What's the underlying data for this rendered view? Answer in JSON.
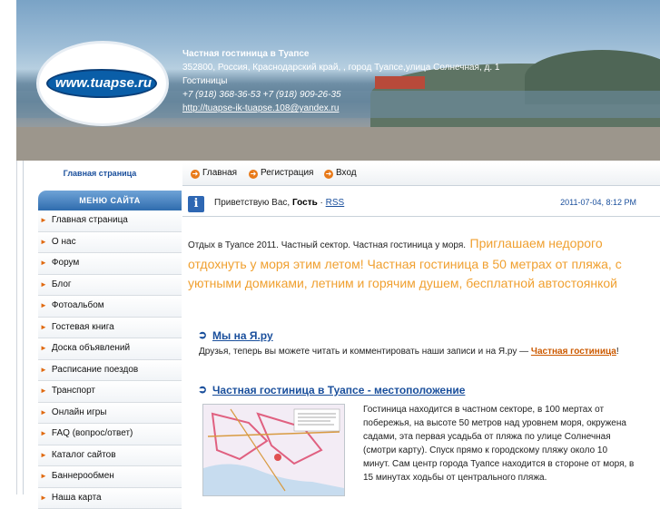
{
  "header": {
    "logo_text": "www.tuapse.ru",
    "title": "Частная гостиница в Туапсе",
    "address": "352800, Россия, Краснодарский край, , город Туапсе,улица Солнечная, д. 1",
    "category": "Гостиницы",
    "phones": "+7 (918) 368-36-53 +7 (918) 909-26-35",
    "email": "http://tuapse-ik-tuapse.108@yandex.ru"
  },
  "sidebar": {
    "home_link": "Главная страница",
    "menu_title": "МЕНЮ САЙТА",
    "items": [
      {
        "label": "Главная страница"
      },
      {
        "label": "О нас"
      },
      {
        "label": "Форум"
      },
      {
        "label": "Блог"
      },
      {
        "label": "Фотоальбом"
      },
      {
        "label": "Гостевая книга"
      },
      {
        "label": "Доска объявлений"
      },
      {
        "label": "Расписание поездов"
      },
      {
        "label": "Транспорт"
      },
      {
        "label": "Онлайн игры"
      },
      {
        "label": "FAQ (вопрос/ответ)"
      },
      {
        "label": "Каталог сайтов"
      },
      {
        "label": "Баннерообмен"
      },
      {
        "label": "Наша карта"
      }
    ]
  },
  "nav": {
    "home": "Главная",
    "register": "Регистрация",
    "login": "Вход"
  },
  "greeting": {
    "prefix": "Приветствую Вас,",
    "user": "Гость",
    "sep": "·",
    "rss": "RSS",
    "datetime": "2011-07-04, 8:12 PM"
  },
  "intro": {
    "small": "Отдых в Туапсе 2011. Частный сектор. Частная гостиница у моря.",
    "big": "Приглашаем недорого отдохнуть у моря этим летом! Частная гостиница в 50 метрах от пляжа, с уютными домиками, летним и горячим душем, бесплатной автостоянкой"
  },
  "posts": [
    {
      "title": "Мы на Я.ру",
      "text": "Друзья, теперь вы можете читать и комментировать наши записи и на Я.ру —",
      "link": "Частная гостиница",
      "end": "!"
    },
    {
      "title": "Частная гостиница в Туапсе - местоположение",
      "text": "Гостиница находится в частном секторе, в 100 мертах от побережья, на высоте 50 метров над уровнем моря, окружена садами, эта первая усадьба от пляжа по улице Солнечная (смотри карту). Спуск прямо к городскому пляжу около 10 минут. Сам центр города Туапсе находится в стороне от моря, в 15 минутах ходьбы от центрального пляжа."
    }
  ],
  "colors": {
    "accent": "#e87a1a",
    "link": "#1a4f9c",
    "menu_header": "#2f6cae",
    "intro_big": "#f0a030"
  }
}
